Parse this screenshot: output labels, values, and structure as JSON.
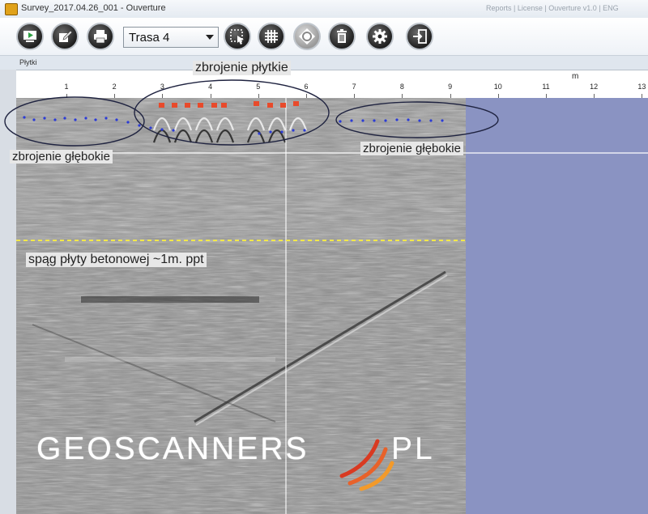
{
  "window": {
    "title": "Survey_2017.04.26_001 - Ouverture",
    "title_right": "Reports | License | Ouverture v1.0 | ENG"
  },
  "toolbar": {
    "buttons": [
      {
        "name": "survey-play-button",
        "icon": "play-icon"
      },
      {
        "name": "edit-button",
        "icon": "edit-icon"
      },
      {
        "name": "print-button",
        "icon": "printer-icon"
      },
      {
        "name": "select-button",
        "icon": "selection-icon"
      },
      {
        "name": "grid-button",
        "icon": "grid-icon"
      },
      {
        "name": "target-button",
        "icon": "target-icon"
      },
      {
        "name": "delete-button",
        "icon": "trash-icon"
      },
      {
        "name": "settings-button",
        "icon": "gear-icon"
      },
      {
        "name": "export-button",
        "icon": "exit-icon"
      }
    ],
    "trace_select": "Trasa 4"
  },
  "panel": {
    "label": "Płytki"
  },
  "ruler": {
    "unit": "m",
    "ticks": [
      "1",
      "2",
      "3",
      "4",
      "5",
      "6",
      "7",
      "8",
      "9",
      "10",
      "11",
      "12",
      "13"
    ]
  },
  "annotations": {
    "shallow": "zbrojenie płytkie",
    "deep_left": "zbrojenie głębokie",
    "deep_right": "zbrojenie głębokie",
    "slab_bottom": "spąg płyty betonowej ~1m. ppt"
  },
  "logo": {
    "text": "GEOSCANNERS",
    "suffix": "PL"
  },
  "colors": {
    "marker_red": "#e84a2b",
    "marker_blue": "#2b3bd6",
    "depth_line": "#f2e84a",
    "logo_orange": "#e8622a"
  }
}
